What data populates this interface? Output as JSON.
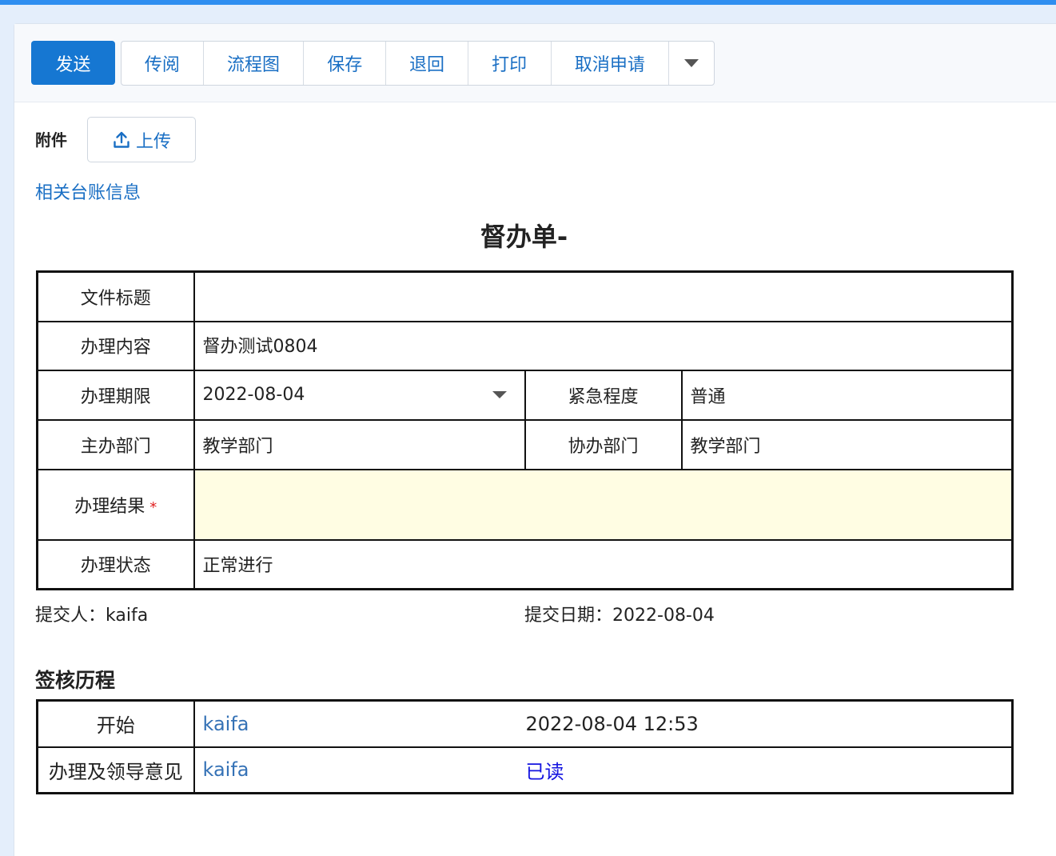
{
  "toolbar": {
    "send": "发送",
    "buttons": [
      "传阅",
      "流程图",
      "保存",
      "退回",
      "打印",
      "取消申请"
    ]
  },
  "attachment": {
    "label": "附件",
    "upload": "上传"
  },
  "ledger_link": "相关台账信息",
  "form": {
    "title": "督办单-",
    "rows": {
      "doc_title": {
        "label": "文件标题",
        "value": ""
      },
      "content": {
        "label": "办理内容",
        "value": "督办测试0804"
      },
      "deadline": {
        "label": "办理期限",
        "value": "2022-08-04"
      },
      "urgency": {
        "label": "紧急程度",
        "value": "普通"
      },
      "main_dept": {
        "label": "主办部门",
        "value": "教学部门"
      },
      "assist_dept": {
        "label": "协办部门",
        "value": "教学部门"
      },
      "result": {
        "label": "办理结果",
        "required_mark": "*",
        "value": ""
      },
      "status": {
        "label": "办理状态",
        "value": "正常进行"
      }
    },
    "submitter_label": "提交人：",
    "submitter": "kaifa",
    "submit_date_label": "提交日期：",
    "submit_date": "2022-08-04"
  },
  "history": {
    "title": "签核历程",
    "rows": [
      {
        "step": "开始",
        "user": "kaifa",
        "info": "2022-08-04 12:53"
      },
      {
        "step": "办理及领导意见",
        "user": "kaifa",
        "info": "已读"
      }
    ]
  },
  "colors": {
    "primary": "#1677d2",
    "link": "#1a6fc4",
    "required": "#e02020",
    "highlight_field": "#fffde3",
    "read_link": "#1515e0"
  }
}
